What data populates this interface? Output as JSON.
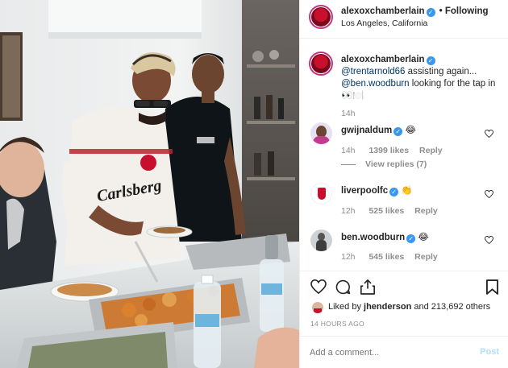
{
  "post": {
    "author": "alexoxchamberlain",
    "following_label": "• Following",
    "location": "Los Angeles, California"
  },
  "caption": {
    "author": "alexoxchamberlain",
    "mention1": "@trentarnold66",
    "text1": " assisting again...",
    "mention2": "@ben.woodburn",
    "text2": " looking for the tap in",
    "emoji": "👀🍽️",
    "time": "14h"
  },
  "comments": [
    {
      "user": "gwijnaldum",
      "emoji": "😂",
      "time": "14h",
      "likes": "1399 likes",
      "reply": "Reply",
      "view_replies": "View replies (7)"
    },
    {
      "user": "liverpoolfc",
      "emoji": "👏",
      "time": "12h",
      "likes": "525 likes",
      "reply": "Reply"
    },
    {
      "user": "ben.woodburn",
      "emoji": "😂",
      "time": "12h",
      "likes": "545 likes",
      "reply": "Reply"
    }
  ],
  "likes": {
    "prefix": "Liked by ",
    "user": "jhenderson",
    "suffix": " and 213,692 others"
  },
  "timestamp": "14 HOURS AGO",
  "input": {
    "placeholder": "Add a comment...",
    "post_label": "Post"
  },
  "photo_text": {
    "sponsor": "Carlsberg"
  },
  "colors": {
    "verified": "#3897f0",
    "link": "#003569",
    "post_disabled": "#b2dffc",
    "muted": "#8e8e8e"
  }
}
